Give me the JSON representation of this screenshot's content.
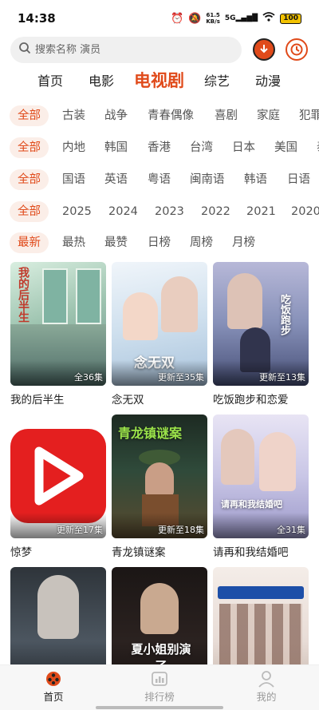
{
  "status_bar": {
    "time": "14:38",
    "net_speed_value": "61.5",
    "net_speed_unit": "KB/s",
    "signal": "5G",
    "battery": "100"
  },
  "search": {
    "placeholder": "搜索名称 演员"
  },
  "top_tabs": [
    "首页",
    "电影",
    "电视剧",
    "综艺",
    "动漫"
  ],
  "active_top_tab": "电视剧",
  "filters": {
    "genre": [
      "全部",
      "古装",
      "战争",
      "青春偶像",
      "喜剧",
      "家庭",
      "犯罪"
    ],
    "region": [
      "全部",
      "内地",
      "韩国",
      "香港",
      "台湾",
      "日本",
      "美国",
      "泰国"
    ],
    "language": [
      "全部",
      "国语",
      "英语",
      "粤语",
      "闽南语",
      "韩语",
      "日语",
      "其他"
    ],
    "year": [
      "全部",
      "2025",
      "2024",
      "2023",
      "2022",
      "2021",
      "2020"
    ],
    "sort": [
      "最新",
      "最热",
      "最赞",
      "日榜",
      "周榜",
      "月榜"
    ]
  },
  "cards": [
    {
      "name": "我的后半生",
      "badge": "全36集",
      "poster_text": "我的后半生",
      "bg": "#9ec4b0"
    },
    {
      "name": "念无双",
      "badge": "更新至35集",
      "poster_text": "念无双",
      "bg": "#cfe0ee"
    },
    {
      "name": "吃饭跑步和恋爱",
      "badge": "更新至13集",
      "poster_text": "吃饭跑步",
      "bg": "#8690b8"
    },
    {
      "name": "惊梦",
      "badge": "更新至17集",
      "poster_text": "",
      "bg": "#ffffff"
    },
    {
      "name": "青龙镇谜案",
      "badge": "更新至18集",
      "poster_text": "青龙镇谜案",
      "bg": "#2f4a3a"
    },
    {
      "name": "请再和我结婚吧",
      "badge": "全31集",
      "poster_text": "请再和我结婚吧",
      "bg": "#c9c6e6"
    },
    {
      "name": "",
      "badge": "",
      "poster_text": "",
      "bg": "#4c5660"
    },
    {
      "name": "",
      "badge": "",
      "poster_text": "夏小姐别演了",
      "bg": "#2b2220"
    },
    {
      "name": "",
      "badge": "",
      "poster_text": "",
      "bg": "#e8dcd6"
    }
  ],
  "bottom_nav": [
    {
      "label": "首页",
      "icon": "home-film-icon"
    },
    {
      "label": "排行榜",
      "icon": "ranking-icon"
    },
    {
      "label": "我的",
      "icon": "profile-icon"
    }
  ],
  "colors": {
    "accent": "#e04a1a",
    "chip_bg": "#fbeee8"
  }
}
